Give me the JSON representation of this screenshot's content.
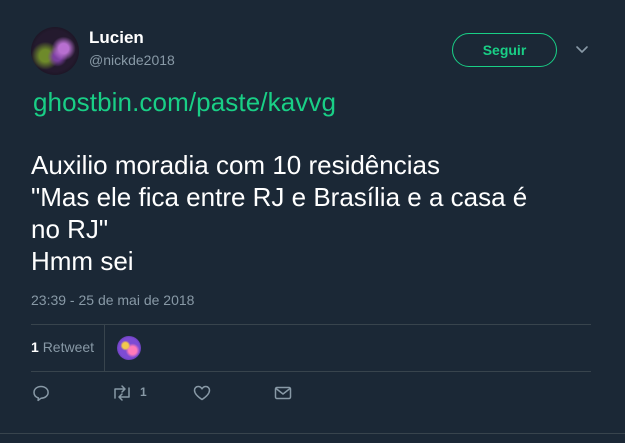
{
  "user": {
    "display_name": "Lucien",
    "handle": "@nickde2018"
  },
  "follow_button": {
    "label": "Seguir"
  },
  "tweet": {
    "link": "ghostbin.com/paste/kavvg",
    "lines": [
      "Auxilio moradia com 10 residências",
      "\"Mas ele fica entre RJ e Brasília e a casa é",
      "no RJ\"",
      "Hmm sei"
    ],
    "timestamp": "23:39 - 25 de mai de 2018"
  },
  "stats": {
    "retweet_count": "1",
    "retweet_label": "Retweet"
  },
  "actions": {
    "reply_icon": "reply-icon",
    "retweet_icon": "retweet-icon",
    "retweet_count": "1",
    "like_icon": "heart-icon",
    "message_icon": "envelope-icon"
  },
  "colors": {
    "background": "#1b2836",
    "accent": "#19cf86",
    "muted": "#8899a6",
    "divider": "#38444d"
  }
}
